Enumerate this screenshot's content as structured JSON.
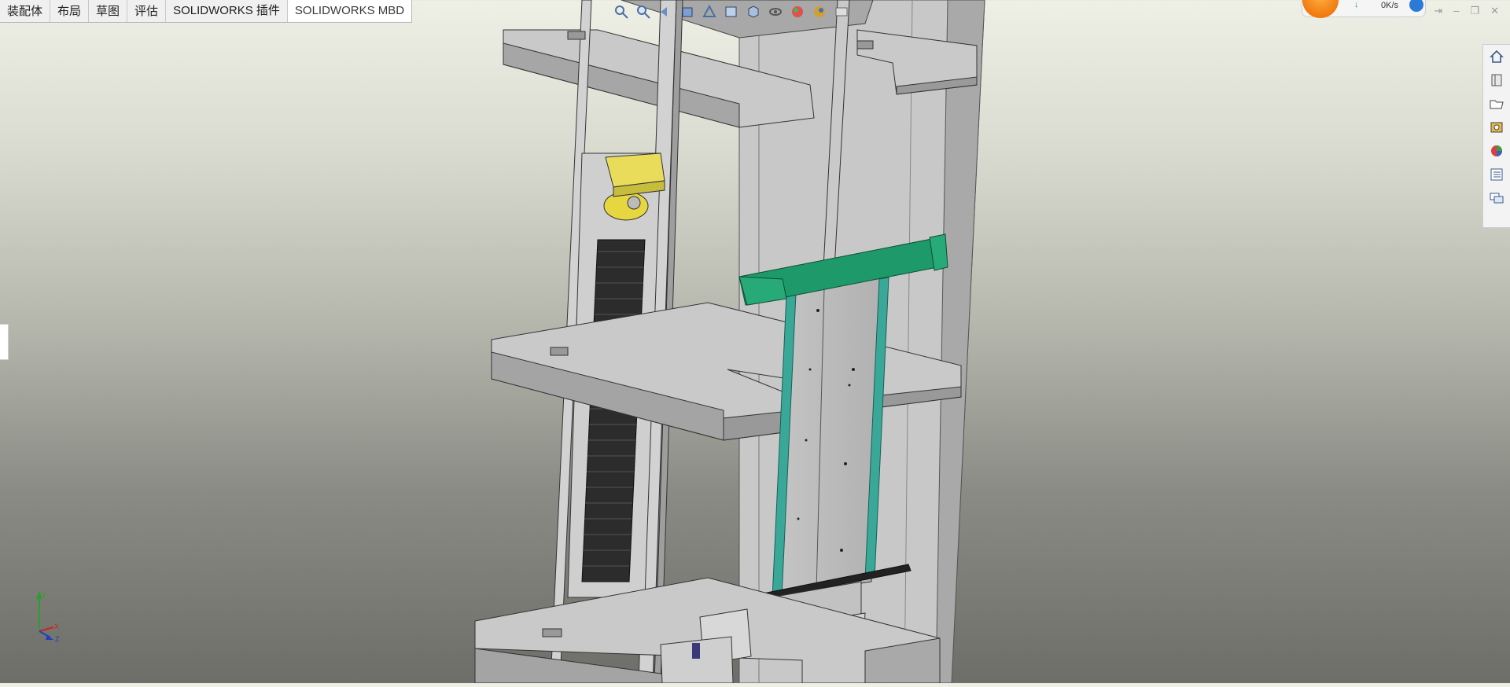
{
  "app": {
    "title": "SOLIDWORKS"
  },
  "command_tabs": [
    {
      "label": "装配体"
    },
    {
      "label": "布局"
    },
    {
      "label": "草图"
    },
    {
      "label": "评估"
    },
    {
      "label": "SOLIDWORKS 插件"
    },
    {
      "label": "SOLIDWORKS MBD"
    }
  ],
  "active_tab": "SOLIDWORKS MBD",
  "heads_up_toolbar": [
    {
      "icon": "zoom-to-fit-icon"
    },
    {
      "icon": "zoom-to-area-icon"
    },
    {
      "icon": "previous-view-icon"
    },
    {
      "icon": "section-view-icon"
    },
    {
      "icon": "dynamic-annotation-icon"
    },
    {
      "icon": "view-orientation-icon"
    },
    {
      "icon": "display-style-icon"
    },
    {
      "icon": "hide-show-items-icon"
    },
    {
      "icon": "edit-appearance-icon"
    },
    {
      "icon": "apply-scene-icon"
    },
    {
      "icon": "view-settings-icon"
    }
  ],
  "network_widget": {
    "speed": "0K/s"
  },
  "task_pane": [
    {
      "icon": "home-icon"
    },
    {
      "icon": "design-library-icon"
    },
    {
      "icon": "file-explorer-icon"
    },
    {
      "icon": "view-palette-icon"
    },
    {
      "icon": "appearances-icon"
    },
    {
      "icon": "custom-properties-icon"
    },
    {
      "icon": "forum-icon"
    }
  ],
  "triad": {
    "x_label": "X",
    "y_label": "Y",
    "z_label": "Z"
  },
  "colors": {
    "accent_green": "#1e9a6a",
    "frame_gray": "#b9b9b9",
    "weight_dark": "#2f2f2f",
    "motor_yellow": "#e8dc5a"
  }
}
